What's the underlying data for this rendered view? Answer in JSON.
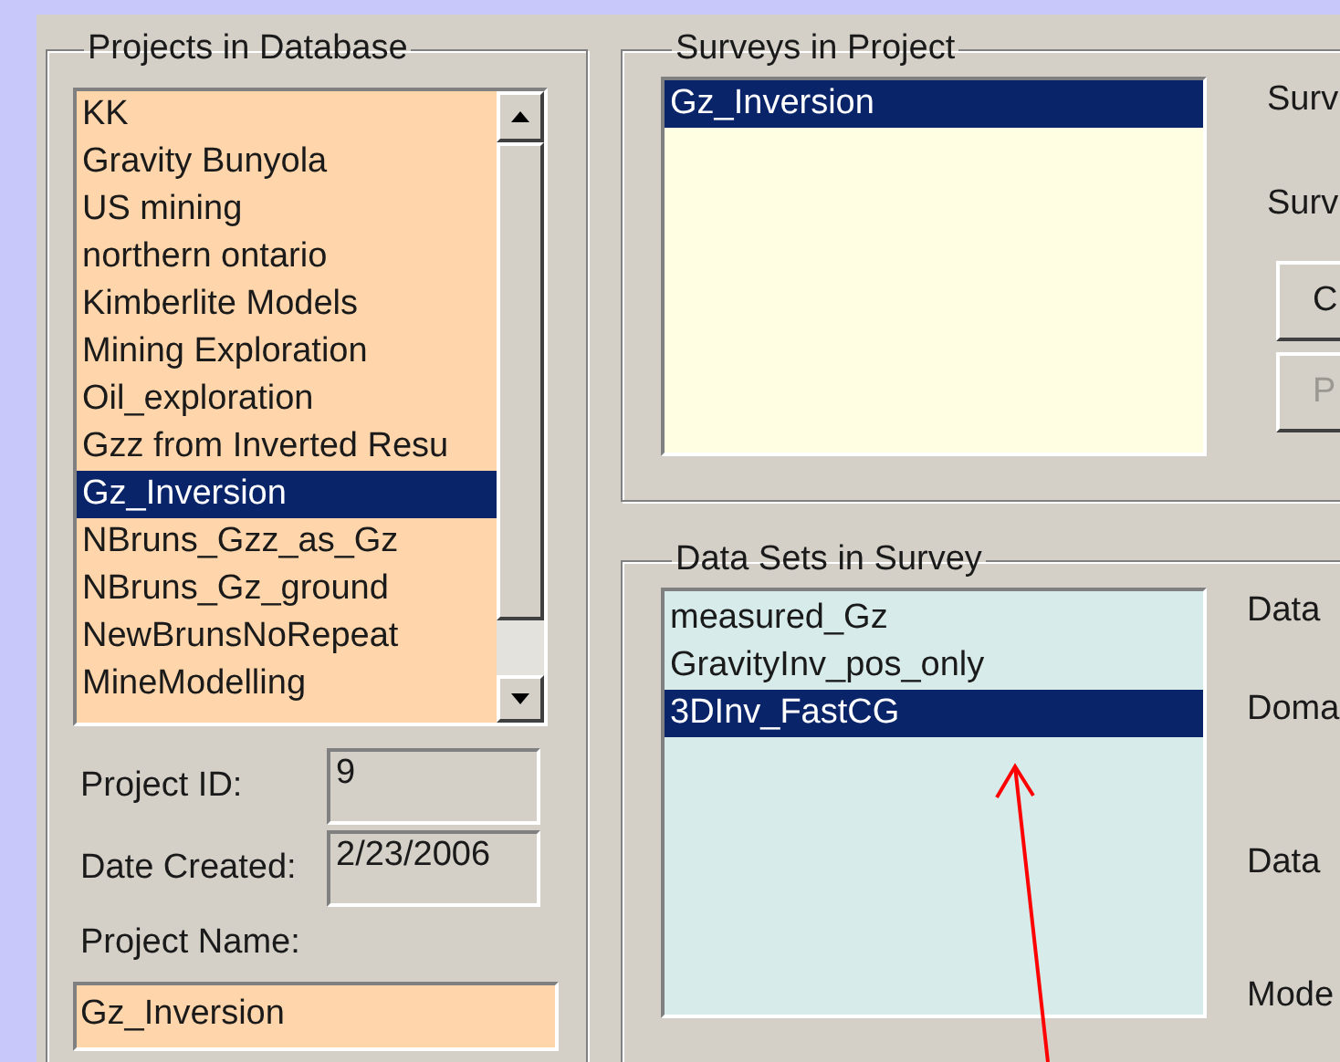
{
  "projects_panel": {
    "title": "Projects in Database",
    "items": [
      {
        "label": "KK",
        "selected": false
      },
      {
        "label": "Gravity Bunyola",
        "selected": false
      },
      {
        "label": "US mining",
        "selected": false
      },
      {
        "label": "northern ontario",
        "selected": false
      },
      {
        "label": "Kimberlite Models",
        "selected": false
      },
      {
        "label": "Mining Exploration",
        "selected": false
      },
      {
        "label": "Oil_exploration",
        "selected": false
      },
      {
        "label": "Gzz from Inverted Resu",
        "selected": false
      },
      {
        "label": "Gz_Inversion",
        "selected": true
      },
      {
        "label": "NBruns_Gzz_as_Gz",
        "selected": false
      },
      {
        "label": "NBruns_Gz_ground",
        "selected": false
      },
      {
        "label": "NewBrunsNoRepeat",
        "selected": false
      },
      {
        "label": "MineModelling",
        "selected": false
      }
    ],
    "fields": [
      {
        "label": "Project ID:",
        "value": "9"
      },
      {
        "label": "Date Created:",
        "value": "2/23/2006"
      }
    ],
    "name_label": "Project Name:",
    "name_value": "Gz_Inversion"
  },
  "surveys_panel": {
    "title": "Surveys in Project",
    "items": [
      {
        "label": "Gz_Inversion",
        "selected": true
      }
    ],
    "labels": [
      "Surv",
      "Surv"
    ],
    "buttons": [
      {
        "label": "C",
        "disabled": false
      },
      {
        "label": "P",
        "disabled": true
      }
    ]
  },
  "datasets_panel": {
    "title": "Data Sets in Survey",
    "items": [
      {
        "label": "measured_Gz",
        "selected": false
      },
      {
        "label": "GravityInv_pos_only",
        "selected": false
      },
      {
        "label": "3DInv_FastCG",
        "selected": true
      }
    ],
    "labels": [
      "Data",
      "Doma",
      "Data",
      "Mode"
    ]
  }
}
